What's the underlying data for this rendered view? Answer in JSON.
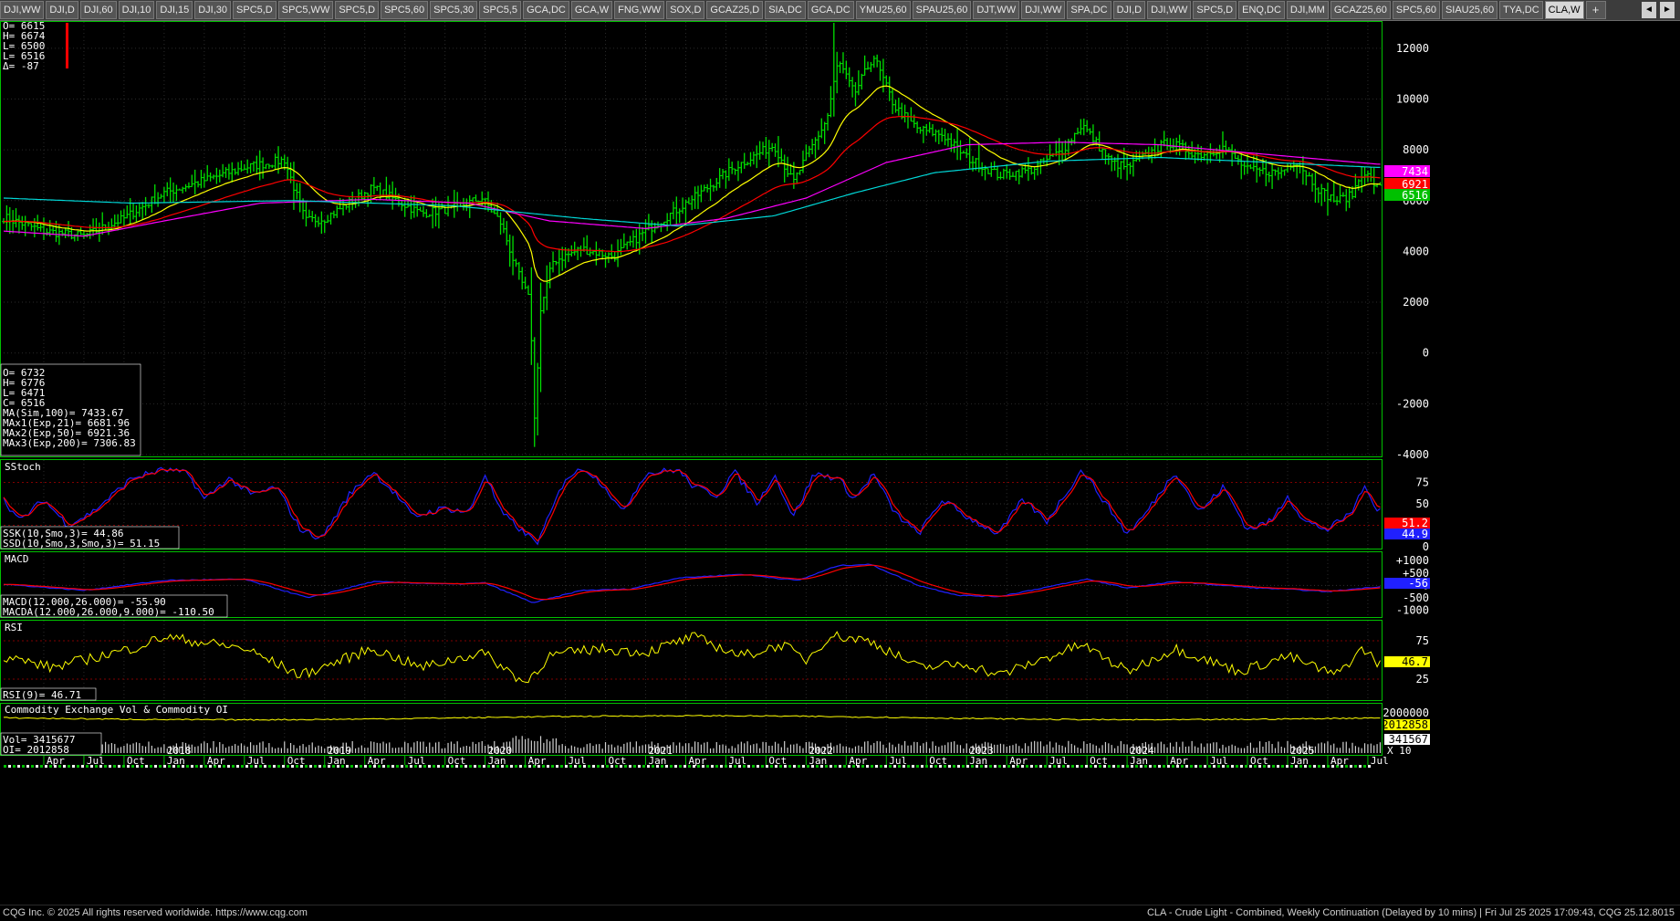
{
  "tabs": [
    "DJI,WW",
    "DJI,D",
    "DJI,60",
    "DJI,10",
    "DJI,15",
    "DJI,30",
    "SPC5,D",
    "SPC5,WW",
    "SPC5,D",
    "SPC5,60",
    "SPC5,30",
    "SPC5,5",
    "GCA,DC",
    "GCA,W",
    "FNG,WW",
    "SOX,D",
    "GCAZ25,D",
    "SIA,DC",
    "GCA,DC",
    "YMU25,60",
    "SPAU25,60",
    "DJT,WW",
    "DJI,WW",
    "SPA,DC",
    "DJI,D",
    "DJI,WW",
    "SPC5,D",
    "ENQ,DC",
    "DJI,MM",
    "GCAZ25,60",
    "SPC5,60",
    "SIAU25,60",
    "TYA,DC",
    "CLA,W"
  ],
  "active_tab": "CLA,W",
  "tab_plus": "+",
  "nav": {
    "left": "◄",
    "right": "►"
  },
  "footer": {
    "left": "CQG Inc. © 2025 All rights reserved worldwide. https://www.cqg.com",
    "right": "CLA - Crude Light - Combined, Weekly Continuation (Delayed by 10 mins) | Fri Jul 25 2025 17:09:43, CQG 25.12.8015"
  },
  "colors": {
    "bar": "#00e000",
    "ma100": "#ff00ff",
    "ma21": "#ffff00",
    "ma50": "#ff0000",
    "ma200": "#00d8d8",
    "macd": "#2020ff",
    "macda": "#ff0000",
    "rsi": "#ffff00",
    "oi": "#ffff00",
    "vol": "#d0d0d0",
    "divider": "#00c000"
  },
  "chart_data": {
    "type": "line",
    "title": "CLA - Crude Light - Combined, Weekly Continuation",
    "price_pane": {
      "ylim": [
        -4000,
        13000
      ],
      "yticks": [
        "12000",
        "10000",
        "8000",
        "6000",
        "4000",
        "2000",
        "0",
        "-2000",
        "-4000"
      ],
      "badges": [
        {
          "value": "7434",
          "color": "#ff00ff"
        },
        {
          "value": "6921",
          "color": "#ff0000"
        },
        {
          "value": "6516",
          "color": "#00c000"
        }
      ],
      "last_bar": [
        "O=   6615",
        "H=   6674",
        "L=   6500",
        "L=   6516",
        "Δ=    -87"
      ],
      "info": [
        "O=              6732",
        "H=              6776",
        "L=              6471",
        "C=              6516",
        "MA(Sim,100)=   7433.67",
        "MAx1(Exp,21)=  6681.96",
        "MAx2(Exp,50)=  6921.36",
        "MAx3(Exp,200)= 7306.83"
      ],
      "close_anchors": [
        {
          "x": 2017.0,
          "y": 5350
        },
        {
          "x": 2017.25,
          "y": 4800
        },
        {
          "x": 2017.5,
          "y": 4600
        },
        {
          "x": 2017.75,
          "y": 5300
        },
        {
          "x": 2018.0,
          "y": 6300
        },
        {
          "x": 2018.25,
          "y": 6800
        },
        {
          "x": 2018.5,
          "y": 7300
        },
        {
          "x": 2018.75,
          "y": 7600
        },
        {
          "x": 2018.88,
          "y": 5200
        },
        {
          "x": 2019.0,
          "y": 5300
        },
        {
          "x": 2019.3,
          "y": 6500
        },
        {
          "x": 2019.6,
          "y": 5500
        },
        {
          "x": 2019.8,
          "y": 5700
        },
        {
          "x": 2019.98,
          "y": 6100
        },
        {
          "x": 2020.1,
          "y": 5100
        },
        {
          "x": 2020.2,
          "y": 3200
        },
        {
          "x": 2020.28,
          "y": 2000
        },
        {
          "x": 2020.31,
          "y": -3000
        },
        {
          "x": 2020.34,
          "y": 1500
        },
        {
          "x": 2020.42,
          "y": 3600
        },
        {
          "x": 2020.6,
          "y": 4100
        },
        {
          "x": 2020.8,
          "y": 3800
        },
        {
          "x": 2021.0,
          "y": 4800
        },
        {
          "x": 2021.3,
          "y": 6100
        },
        {
          "x": 2021.55,
          "y": 7300
        },
        {
          "x": 2021.8,
          "y": 8200
        },
        {
          "x": 2021.92,
          "y": 6700
        },
        {
          "x": 2022.0,
          "y": 7700
        },
        {
          "x": 2022.13,
          "y": 9200
        },
        {
          "x": 2022.2,
          "y": 11500
        },
        {
          "x": 2022.3,
          "y": 10200
        },
        {
          "x": 2022.42,
          "y": 11700
        },
        {
          "x": 2022.55,
          "y": 9700
        },
        {
          "x": 2022.7,
          "y": 8800
        },
        {
          "x": 2022.85,
          "y": 8600
        },
        {
          "x": 2023.0,
          "y": 7700
        },
        {
          "x": 2023.2,
          "y": 7000
        },
        {
          "x": 2023.4,
          "y": 7200
        },
        {
          "x": 2023.6,
          "y": 8000
        },
        {
          "x": 2023.72,
          "y": 9000
        },
        {
          "x": 2023.9,
          "y": 7500
        },
        {
          "x": 2024.0,
          "y": 7300
        },
        {
          "x": 2024.25,
          "y": 8300
        },
        {
          "x": 2024.45,
          "y": 7800
        },
        {
          "x": 2024.6,
          "y": 8100
        },
        {
          "x": 2024.75,
          "y": 7200
        },
        {
          "x": 2024.95,
          "y": 7100
        },
        {
          "x": 2025.05,
          "y": 7600
        },
        {
          "x": 2025.2,
          "y": 6400
        },
        {
          "x": 2025.3,
          "y": 6000
        },
        {
          "x": 2025.4,
          "y": 6200
        },
        {
          "x": 2025.47,
          "y": 7200
        },
        {
          "x": 2025.56,
          "y": 6500
        }
      ],
      "ma100_anchors": [
        {
          "x": 2017.0,
          "y": 4800
        },
        {
          "x": 2017.5,
          "y": 4600
        },
        {
          "x": 2018.0,
          "y": 5200
        },
        {
          "x": 2018.6,
          "y": 5900
        },
        {
          "x": 2019.3,
          "y": 6050
        },
        {
          "x": 2019.9,
          "y": 5900
        },
        {
          "x": 2020.4,
          "y": 5200
        },
        {
          "x": 2021.0,
          "y": 4900
        },
        {
          "x": 2021.5,
          "y": 5300
        },
        {
          "x": 2022.0,
          "y": 6100
        },
        {
          "x": 2022.5,
          "y": 7500
        },
        {
          "x": 2023.0,
          "y": 8200
        },
        {
          "x": 2023.6,
          "y": 8300
        },
        {
          "x": 2024.2,
          "y": 8200
        },
        {
          "x": 2024.9,
          "y": 7800
        },
        {
          "x": 2025.56,
          "y": 7434
        }
      ],
      "ma200_anchors": [
        {
          "x": 2017.0,
          "y": 6100
        },
        {
          "x": 2017.8,
          "y": 5900
        },
        {
          "x": 2018.8,
          "y": 6000
        },
        {
          "x": 2019.8,
          "y": 5800
        },
        {
          "x": 2020.6,
          "y": 5300
        },
        {
          "x": 2021.2,
          "y": 5000
        },
        {
          "x": 2021.8,
          "y": 5400
        },
        {
          "x": 2022.3,
          "y": 6300
        },
        {
          "x": 2022.8,
          "y": 7100
        },
        {
          "x": 2023.5,
          "y": 7550
        },
        {
          "x": 2024.2,
          "y": 7700
        },
        {
          "x": 2024.9,
          "y": 7500
        },
        {
          "x": 2025.56,
          "y": 7307
        }
      ]
    },
    "stoch_pane": {
      "ylim": [
        0,
        100
      ],
      "yticks": [
        "75",
        "50",
        "25",
        "0"
      ],
      "badges": [
        {
          "value": "51.2",
          "color": "#ff0000"
        },
        {
          "value": "44.9",
          "color": "#2020ff"
        }
      ],
      "info": [
        "SSK(10,Smo,3)=        44.86",
        "SSD(10,Smo,3,Smo,3)=   51.15"
      ],
      "title": "SStoch",
      "k_anchors": [
        {
          "x": 2017.0,
          "y": 55
        },
        {
          "x": 2017.1,
          "y": 30
        },
        {
          "x": 2017.25,
          "y": 55
        },
        {
          "x": 2017.4,
          "y": 25
        },
        {
          "x": 2017.55,
          "y": 40
        },
        {
          "x": 2017.8,
          "y": 80
        },
        {
          "x": 2018.0,
          "y": 90
        },
        {
          "x": 2018.15,
          "y": 85
        },
        {
          "x": 2018.25,
          "y": 55
        },
        {
          "x": 2018.4,
          "y": 80
        },
        {
          "x": 2018.55,
          "y": 60
        },
        {
          "x": 2018.7,
          "y": 70
        },
        {
          "x": 2018.85,
          "y": 20
        },
        {
          "x": 2018.98,
          "y": 10
        },
        {
          "x": 2019.15,
          "y": 60
        },
        {
          "x": 2019.3,
          "y": 88
        },
        {
          "x": 2019.45,
          "y": 60
        },
        {
          "x": 2019.55,
          "y": 35
        },
        {
          "x": 2019.75,
          "y": 45
        },
        {
          "x": 2019.9,
          "y": 40
        },
        {
          "x": 2020.0,
          "y": 85
        },
        {
          "x": 2020.1,
          "y": 40
        },
        {
          "x": 2020.25,
          "y": 15
        },
        {
          "x": 2020.33,
          "y": 5
        },
        {
          "x": 2020.5,
          "y": 80
        },
        {
          "x": 2020.62,
          "y": 92
        },
        {
          "x": 2020.75,
          "y": 70
        },
        {
          "x": 2020.85,
          "y": 40
        },
        {
          "x": 2021.0,
          "y": 85
        },
        {
          "x": 2021.2,
          "y": 90
        },
        {
          "x": 2021.3,
          "y": 70
        },
        {
          "x": 2021.45,
          "y": 60
        },
        {
          "x": 2021.55,
          "y": 88
        },
        {
          "x": 2021.7,
          "y": 50
        },
        {
          "x": 2021.8,
          "y": 85
        },
        {
          "x": 2021.92,
          "y": 35
        },
        {
          "x": 2022.05,
          "y": 85
        },
        {
          "x": 2022.2,
          "y": 80
        },
        {
          "x": 2022.3,
          "y": 55
        },
        {
          "x": 2022.42,
          "y": 85
        },
        {
          "x": 2022.55,
          "y": 40
        },
        {
          "x": 2022.7,
          "y": 15
        },
        {
          "x": 2022.85,
          "y": 55
        },
        {
          "x": 2023.0,
          "y": 35
        },
        {
          "x": 2023.2,
          "y": 15
        },
        {
          "x": 2023.35,
          "y": 55
        },
        {
          "x": 2023.5,
          "y": 30
        },
        {
          "x": 2023.72,
          "y": 90
        },
        {
          "x": 2023.85,
          "y": 55
        },
        {
          "x": 2024.0,
          "y": 15
        },
        {
          "x": 2024.1,
          "y": 35
        },
        {
          "x": 2024.3,
          "y": 88
        },
        {
          "x": 2024.45,
          "y": 40
        },
        {
          "x": 2024.6,
          "y": 70
        },
        {
          "x": 2024.75,
          "y": 20
        },
        {
          "x": 2024.9,
          "y": 30
        },
        {
          "x": 2025.0,
          "y": 60
        },
        {
          "x": 2025.1,
          "y": 30
        },
        {
          "x": 2025.25,
          "y": 20
        },
        {
          "x": 2025.4,
          "y": 40
        },
        {
          "x": 2025.47,
          "y": 70
        },
        {
          "x": 2025.56,
          "y": 45
        }
      ]
    },
    "macd_pane": {
      "ylim": [
        -1200,
        1300
      ],
      "yticks": [
        "+1000",
        "+500",
        "0",
        "-500",
        "-1000"
      ],
      "badges": [
        {
          "value": "-56",
          "color": "#2020ff"
        }
      ],
      "info": [
        "MACD(12.000,26.000)=       -55.90",
        "MACDA(12.000,26.000,9.000)= -110.50"
      ],
      "title": "MACD",
      "macd_anchors": [
        {
          "x": 2017.0,
          "y": 50
        },
        {
          "x": 2017.5,
          "y": -200
        },
        {
          "x": 2018.0,
          "y": 200
        },
        {
          "x": 2018.5,
          "y": 250
        },
        {
          "x": 2018.9,
          "y": -500
        },
        {
          "x": 2019.3,
          "y": 150
        },
        {
          "x": 2019.8,
          "y": 50
        },
        {
          "x": 2020.0,
          "y": 100
        },
        {
          "x": 2020.3,
          "y": -700
        },
        {
          "x": 2020.6,
          "y": -200
        },
        {
          "x": 2020.9,
          "y": -150
        },
        {
          "x": 2021.2,
          "y": 300
        },
        {
          "x": 2021.6,
          "y": 450
        },
        {
          "x": 2021.95,
          "y": 200
        },
        {
          "x": 2022.2,
          "y": 800
        },
        {
          "x": 2022.4,
          "y": 850
        },
        {
          "x": 2022.7,
          "y": 0
        },
        {
          "x": 2022.95,
          "y": -400
        },
        {
          "x": 2023.2,
          "y": -450
        },
        {
          "x": 2023.75,
          "y": 250
        },
        {
          "x": 2024.0,
          "y": -100
        },
        {
          "x": 2024.3,
          "y": 150
        },
        {
          "x": 2024.8,
          "y": -100
        },
        {
          "x": 2025.0,
          "y": -150
        },
        {
          "x": 2025.25,
          "y": -250
        },
        {
          "x": 2025.56,
          "y": -56
        }
      ]
    },
    "rsi_pane": {
      "ylim": [
        0,
        100
      ],
      "yticks": [
        "75",
        "25"
      ],
      "badges": [
        {
          "value": "46.7",
          "color": "#ffff00"
        }
      ],
      "info": [
        "RSI(9)=   46.71"
      ],
      "title": "RSI",
      "rsi_anchors": [
        {
          "x": 2017.0,
          "y": 55
        },
        {
          "x": 2017.3,
          "y": 40
        },
        {
          "x": 2017.8,
          "y": 65
        },
        {
          "x": 2018.0,
          "y": 80
        },
        {
          "x": 2018.5,
          "y": 65
        },
        {
          "x": 2018.85,
          "y": 30
        },
        {
          "x": 2019.3,
          "y": 65
        },
        {
          "x": 2019.6,
          "y": 40
        },
        {
          "x": 2019.98,
          "y": 60
        },
        {
          "x": 2020.25,
          "y": 20
        },
        {
          "x": 2020.4,
          "y": 55
        },
        {
          "x": 2020.7,
          "y": 65
        },
        {
          "x": 2021.0,
          "y": 60
        },
        {
          "x": 2021.3,
          "y": 80
        },
        {
          "x": 2021.6,
          "y": 55
        },
        {
          "x": 2021.85,
          "y": 70
        },
        {
          "x": 2022.0,
          "y": 50
        },
        {
          "x": 2022.15,
          "y": 82
        },
        {
          "x": 2022.4,
          "y": 75
        },
        {
          "x": 2022.7,
          "y": 40
        },
        {
          "x": 2023.0,
          "y": 45
        },
        {
          "x": 2023.2,
          "y": 30
        },
        {
          "x": 2023.72,
          "y": 70
        },
        {
          "x": 2024.0,
          "y": 35
        },
        {
          "x": 2024.3,
          "y": 65
        },
        {
          "x": 2024.7,
          "y": 35
        },
        {
          "x": 2025.0,
          "y": 55
        },
        {
          "x": 2025.3,
          "y": 30
        },
        {
          "x": 2025.47,
          "y": 65
        },
        {
          "x": 2025.56,
          "y": 47
        }
      ]
    },
    "vol_pane": {
      "ylim": [
        0,
        2400000
      ],
      "yticks": [
        "2000000"
      ],
      "badges": [
        {
          "value": "2012858",
          "color": "#ffff00"
        },
        {
          "value": "341567",
          "color": "#ffffff"
        }
      ],
      "info": [
        "Vol=   3415677",
        "OI=    2012858"
      ],
      "title": "Commodity Exchange Vol & Commodity OI",
      "x_multiplier": "X 10"
    },
    "x_axis": {
      "range": [
        2017.0,
        2025.58
      ],
      "month_labels": [
        "Apr",
        "Jul",
        "Oct",
        "Jan",
        "Apr",
        "Jul",
        "Oct",
        "Jan",
        "Apr",
        "Jul",
        "Oct",
        "Jan",
        "Apr",
        "Jul",
        "Oct",
        "Jan",
        "Apr",
        "Jul",
        "Oct",
        "Jan",
        "Apr",
        "Jul",
        "Oct",
        "Jan",
        "Apr",
        "Jul",
        "Oct",
        "Jan",
        "Apr",
        "Jul",
        "Oct",
        "Jan",
        "Apr",
        "Jul",
        "Oct",
        "Jan",
        "Apr",
        "Jul"
      ],
      "year_labels": [
        "2018",
        "2019",
        "2020",
        "2021",
        "2022",
        "2023",
        "2024",
        "2025"
      ]
    }
  }
}
